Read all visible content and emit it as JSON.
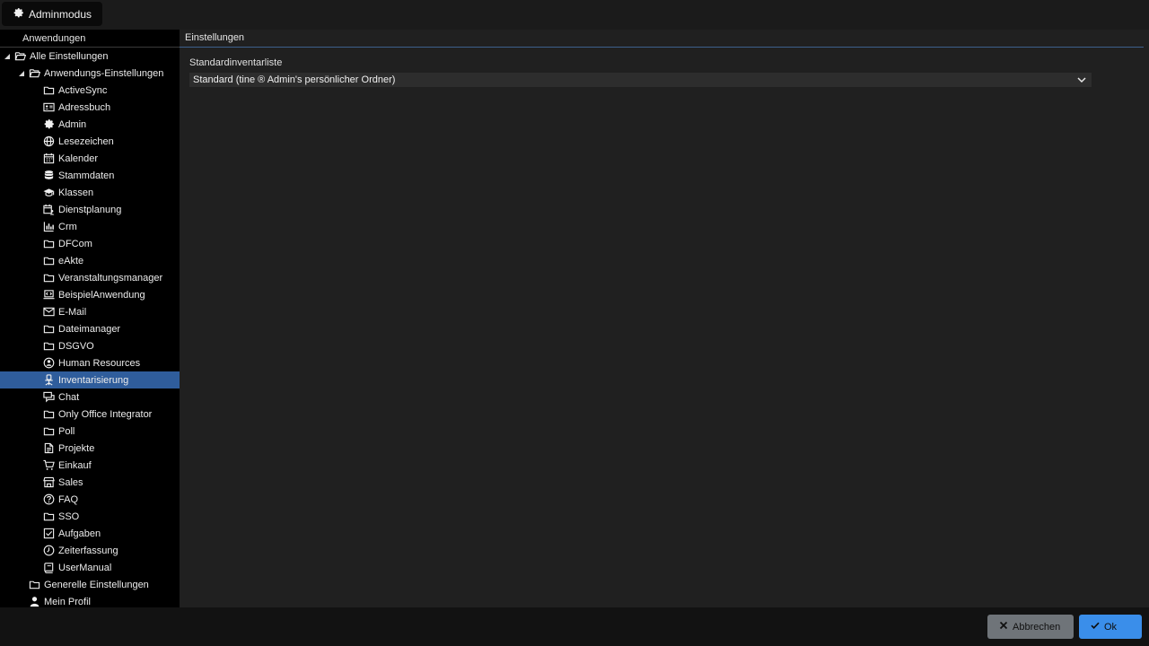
{
  "topbar": {
    "admin_label": "Adminmodus",
    "admin_icon": "gear-icon"
  },
  "sidebar": {
    "header": "Anwendungen",
    "root": {
      "label": "Alle Einstellungen",
      "icon": "folder-open-icon"
    },
    "app_settings": {
      "label": "Anwendungs-Einstellungen",
      "icon": "folder-open-icon"
    },
    "items": [
      {
        "label": "ActiveSync",
        "icon": "folder-icon"
      },
      {
        "label": "Adressbuch",
        "icon": "address-card-icon"
      },
      {
        "label": "Admin",
        "icon": "gear-icon"
      },
      {
        "label": "Lesezeichen",
        "icon": "globe-icon"
      },
      {
        "label": "Kalender",
        "icon": "calendar-icon"
      },
      {
        "label": "Stammdaten",
        "icon": "database-icon"
      },
      {
        "label": "Klassen",
        "icon": "graduation-cap-icon"
      },
      {
        "label": "Dienstplanung",
        "icon": "calendar-user-icon"
      },
      {
        "label": "Crm",
        "icon": "bar-chart-icon"
      },
      {
        "label": "DFCom",
        "icon": "folder-icon"
      },
      {
        "label": "eAkte",
        "icon": "folder-icon"
      },
      {
        "label": "Veranstaltungsmanager",
        "icon": "folder-icon"
      },
      {
        "label": "BeispielAnwendung",
        "icon": "laptop-code-icon"
      },
      {
        "label": "E-Mail",
        "icon": "envelope-icon"
      },
      {
        "label": "Dateimanager",
        "icon": "folder-icon"
      },
      {
        "label": "DSGVO",
        "icon": "folder-icon"
      },
      {
        "label": "Human Resources",
        "icon": "user-search-icon"
      },
      {
        "label": "Inventarisierung",
        "icon": "office-chair-icon"
      },
      {
        "label": "Chat",
        "icon": "chat-icon"
      },
      {
        "label": "Only Office Integrator",
        "icon": "folder-icon"
      },
      {
        "label": "Poll",
        "icon": "folder-icon"
      },
      {
        "label": "Projekte",
        "icon": "document-icon"
      },
      {
        "label": "Einkauf",
        "icon": "cart-icon"
      },
      {
        "label": "Sales",
        "icon": "store-icon"
      },
      {
        "label": "FAQ",
        "icon": "question-circle-icon"
      },
      {
        "label": "SSO",
        "icon": "folder-icon"
      },
      {
        "label": "Aufgaben",
        "icon": "checkbox-icon"
      },
      {
        "label": "Zeiterfassung",
        "icon": "clock-icon"
      },
      {
        "label": "UserManual",
        "icon": "book-icon"
      }
    ],
    "selected_index": 17,
    "general": {
      "label": "Generelle Einstellungen",
      "icon": "folder-icon"
    },
    "profile": {
      "label": "Mein Profil",
      "icon": "user-icon"
    }
  },
  "main": {
    "header": "Einstellungen",
    "field_label": "Standardinventarliste",
    "field_value": "Standard (tine ® Admin's persönlicher Ordner)"
  },
  "footer": {
    "cancel_label": "Abbrechen",
    "ok_label": "Ok"
  },
  "colors": {
    "selection": "#2f5d9c",
    "ok_button": "#3a8eea",
    "cancel_button": "#6f7479"
  }
}
